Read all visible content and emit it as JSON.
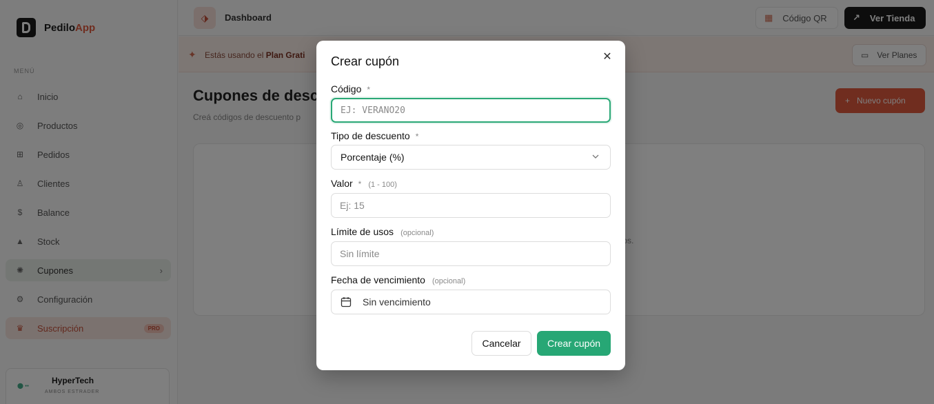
{
  "app": {
    "brand_main": "Pedilo",
    "brand_accent": "App"
  },
  "sidebar": {
    "section_label": "MENÚ",
    "items": [
      {
        "label": "Inicio",
        "icon": "home-icon"
      },
      {
        "label": "Productos",
        "icon": "box-icon"
      },
      {
        "label": "Pedidos",
        "icon": "cart-icon"
      },
      {
        "label": "Clientes",
        "icon": "users-icon"
      },
      {
        "label": "Balance",
        "icon": "dollar-icon"
      },
      {
        "label": "Stock",
        "icon": "stock-icon"
      },
      {
        "label": "Cupones",
        "icon": "ticket-icon",
        "active": true
      },
      {
        "label": "Configuración",
        "icon": "gear-icon"
      }
    ],
    "subscription": {
      "label": "Suscripción",
      "badge": "PRO"
    },
    "user": {
      "name": "HyperTech",
      "role": "AMBOS ESTRADER"
    }
  },
  "topbar": {
    "title": "Dashboard",
    "qr_label": "Código QR",
    "store_label": "Ver Tienda"
  },
  "banner": {
    "text_prefix": "Estás usando el",
    "text_plan": "Plan Grati",
    "plans_label": "Ver Planes"
  },
  "main": {
    "title": "Cupones de desc",
    "subtitle": "Creá códigos de descuento p",
    "new_button": "Nuevo cupón",
    "empty_text_fragment": "uentos."
  },
  "modal": {
    "title": "Crear cupón",
    "fields": {
      "code": {
        "label": "Código",
        "required": "*",
        "placeholder": "EJ: VERANO20",
        "value": ""
      },
      "type": {
        "label": "Tipo de descuento",
        "required": "*",
        "selected": "Porcentaje (%)"
      },
      "value": {
        "label": "Valor",
        "required": "*",
        "hint": "(1 - 100)",
        "placeholder": "Ej: 15"
      },
      "limit": {
        "label": "Límite de usos",
        "hint": "(opcional)",
        "placeholder": "Sin límite"
      },
      "expiry": {
        "label": "Fecha de vencimiento",
        "hint": "(opcional)",
        "value": "Sin vencimiento"
      }
    },
    "cancel_label": "Cancelar",
    "submit_label": "Crear cupón"
  },
  "colors": {
    "accent_green": "#27a775",
    "accent_orange": "#e05a3f",
    "overlay": "rgba(0,0,0,0.5)"
  }
}
